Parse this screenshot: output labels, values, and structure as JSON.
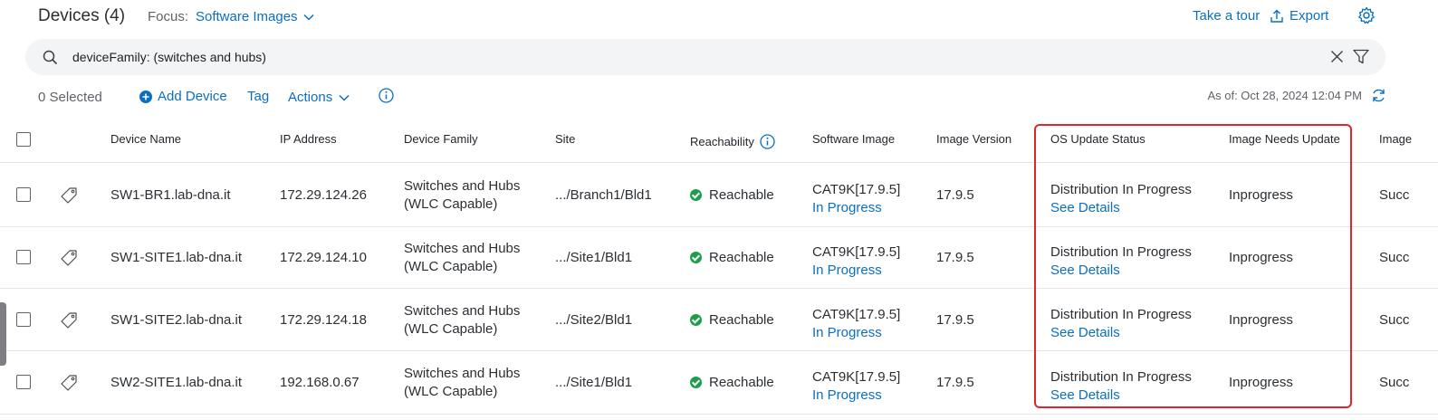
{
  "header": {
    "title": "Devices (4)",
    "focus_label": "Focus:",
    "focus_value": "Software Images",
    "take_tour": "Take a tour",
    "export": "Export"
  },
  "search": {
    "value": "deviceFamily: (switches and hubs)"
  },
  "toolbar": {
    "selected": "0 Selected",
    "add_device": "Add Device",
    "tag": "Tag",
    "actions": "Actions",
    "as_of": "As of: Oct 28, 2024 12:04 PM"
  },
  "table": {
    "columns": {
      "device_name": "Device Name",
      "ip": "IP Address",
      "family": "Device Family",
      "site": "Site",
      "reach": "Reachability",
      "software_image": "Software Image",
      "image_version": "Image Version",
      "os_status": "OS Update Status",
      "needs_update": "Image Needs Update",
      "image_trunc": "Image"
    },
    "rows": [
      {
        "name": "SW1-BR1.lab-dna.it",
        "ip": "172.29.124.26",
        "family1": "Switches and Hubs",
        "family2": "(WLC Capable)",
        "site": ".../Branch1/Bld1",
        "reach": "Reachable",
        "image": "CAT9K[17.9.5]",
        "image_status": "In Progress",
        "version": "17.9.5",
        "os_status": "Distribution In Progress",
        "os_link": "See Details",
        "needs": "Inprogress",
        "trunc": "Succ"
      },
      {
        "name": "SW1-SITE1.lab-dna.it",
        "ip": "172.29.124.10",
        "family1": "Switches and Hubs",
        "family2": "(WLC Capable)",
        "site": ".../Site1/Bld1",
        "reach": "Reachable",
        "image": "CAT9K[17.9.5]",
        "image_status": "In Progress",
        "version": "17.9.5",
        "os_status": "Distribution In Progress",
        "os_link": "See Details",
        "needs": "Inprogress",
        "trunc": "Succ"
      },
      {
        "name": "SW1-SITE2.lab-dna.it",
        "ip": "172.29.124.18",
        "family1": "Switches and Hubs",
        "family2": "(WLC Capable)",
        "site": ".../Site2/Bld1",
        "reach": "Reachable",
        "image": "CAT9K[17.9.5]",
        "image_status": "In Progress",
        "version": "17.9.5",
        "os_status": "Distribution In Progress",
        "os_link": "See Details",
        "needs": "Inprogress",
        "trunc": "Succ"
      },
      {
        "name": "SW2-SITE1.lab-dna.it",
        "ip": "192.168.0.67",
        "family1": "Switches and Hubs",
        "family2": "(WLC Capable)",
        "site": ".../Site1/Bld1",
        "reach": "Reachable",
        "image": "CAT9K[17.9.5]",
        "image_status": "In Progress",
        "version": "17.9.5",
        "os_status": "Distribution In Progress",
        "os_link": "See Details",
        "needs": "Inprogress",
        "trunc": "Succ"
      }
    ]
  },
  "colors": {
    "accent": "#0a6fc2",
    "reachable": "#1e9e4a",
    "highlight": "#e0262b"
  }
}
